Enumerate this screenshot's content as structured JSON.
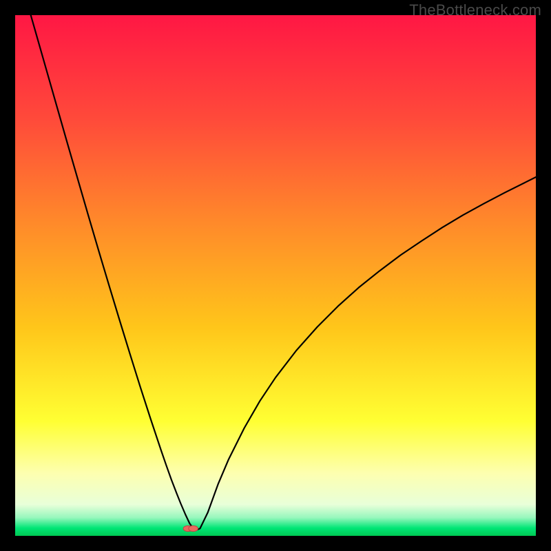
{
  "watermark": "TheBottleneck.com",
  "chart_data": {
    "type": "line",
    "title": "",
    "xlabel": "",
    "ylabel": "",
    "xlim": [
      0,
      100
    ],
    "ylim": [
      0,
      100
    ],
    "grid": false,
    "legend": false,
    "black_border": true,
    "background_gradient": {
      "stops": [
        {
          "offset": 0.0,
          "color": "#ff1744"
        },
        {
          "offset": 0.2,
          "color": "#ff4a3a"
        },
        {
          "offset": 0.4,
          "color": "#ff8a2a"
        },
        {
          "offset": 0.6,
          "color": "#ffc61a"
        },
        {
          "offset": 0.78,
          "color": "#ffff33"
        },
        {
          "offset": 0.88,
          "color": "#fdffb0"
        },
        {
          "offset": 0.94,
          "color": "#e8ffd9"
        },
        {
          "offset": 0.965,
          "color": "#97f7bd"
        },
        {
          "offset": 0.985,
          "color": "#00e676"
        },
        {
          "offset": 1.0,
          "color": "#00c853"
        }
      ]
    },
    "curve": {
      "stroke": "#000000",
      "stroke_width": 2.2,
      "x": [
        3.0,
        4.0,
        6.0,
        8.0,
        10.0,
        12.0,
        14.0,
        16.0,
        18.0,
        20.0,
        22.0,
        24.0,
        26.0,
        28.0,
        29.0,
        30.0,
        31.0,
        31.8,
        32.7,
        33.5,
        34.5,
        35.5,
        37.0,
        39.0,
        41.0,
        44.0,
        47.0,
        50.0,
        54.0,
        58.0,
        62.0,
        66.0,
        70.0,
        74.0,
        78.0,
        82.0,
        86.0,
        90.0,
        94.0,
        98.0,
        100.0
      ],
      "y": [
        100.0,
        96.5,
        89.5,
        82.5,
        75.5,
        68.6,
        61.7,
        54.9,
        48.2,
        41.6,
        35.1,
        28.7,
        22.5,
        16.5,
        13.6,
        10.8,
        8.2,
        6.2,
        4.1,
        2.4,
        1.0,
        1.4,
        4.5,
        10.0,
        14.7,
        20.7,
        25.9,
        30.4,
        35.6,
        40.1,
        44.1,
        47.7,
        50.9,
        53.9,
        56.6,
        59.2,
        61.6,
        63.8,
        65.9,
        67.9,
        68.9
      ]
    },
    "markers": [
      {
        "x": 33.2,
        "y": 1.4,
        "shape": "oval",
        "rx": 0.9,
        "ry": 0.55,
        "fill": "#e8695e",
        "stroke": "#c44a47"
      },
      {
        "x": 34.2,
        "y": 1.4,
        "shape": "oval",
        "rx": 0.9,
        "ry": 0.55,
        "fill": "#e8695e",
        "stroke": "#c44a47"
      }
    ]
  }
}
